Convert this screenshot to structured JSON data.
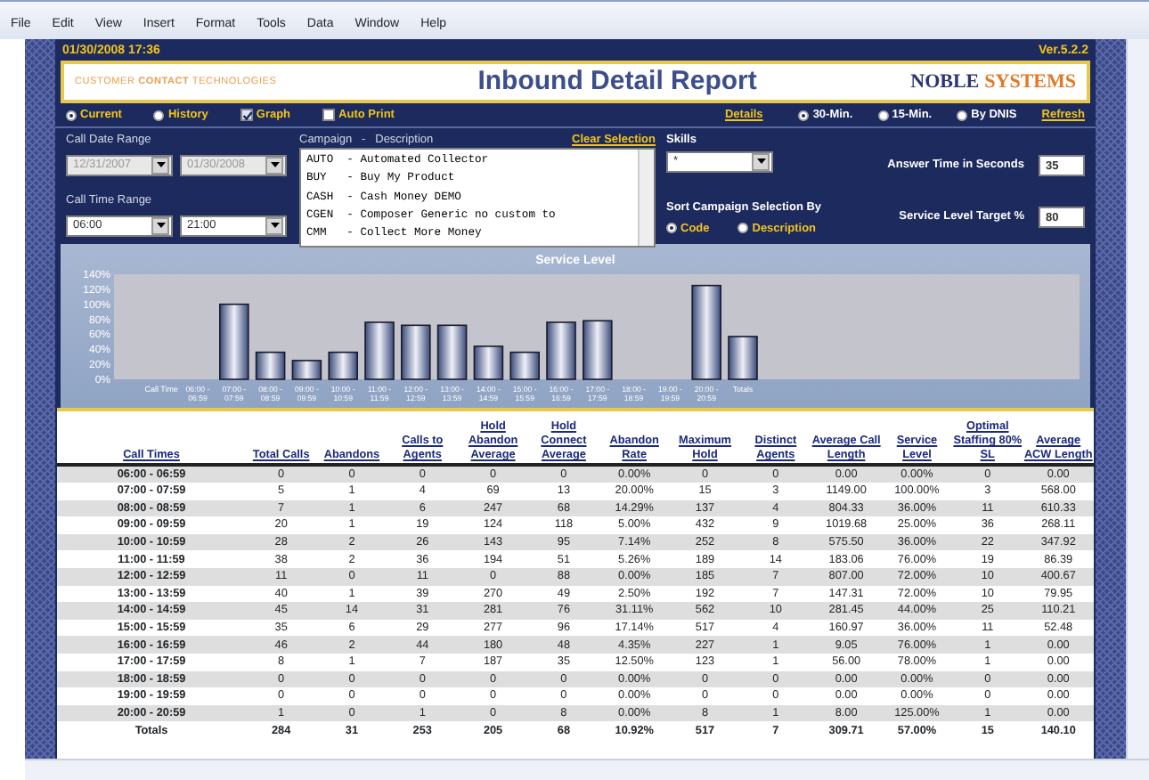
{
  "menu": [
    "File",
    "Edit",
    "View",
    "Insert",
    "Format",
    "Tools",
    "Data",
    "Window",
    "Help"
  ],
  "header": {
    "datetime": "01/30/2008 17:36",
    "version": "Ver.5.2.2",
    "tagline": "CUSTOMER **CONTACT** TECHNOLOGIES",
    "title": "Inbound Detail Report",
    "logo_word_1": "NOBLE",
    "logo_word_2": "SYSTEMS"
  },
  "mode_options": [
    {
      "label": "Current",
      "selected": true
    },
    {
      "label": "History",
      "selected": false
    }
  ],
  "checkboxes": [
    {
      "label": "Graph",
      "checked": true
    },
    {
      "label": "Auto Print",
      "checked": false
    }
  ],
  "details_link": "Details",
  "interval_options": [
    {
      "label": "30-Min.",
      "selected": true
    },
    {
      "label": "15-Min.",
      "selected": false
    },
    {
      "label": "By DNIS",
      "selected": false
    }
  ],
  "refresh_link": "Refresh",
  "call_date_range": {
    "label": "Call Date Range",
    "from": "12/31/2007",
    "to": "01/30/2008",
    "disabled": true
  },
  "call_time_range": {
    "label": "Call Time Range",
    "from": "06:00",
    "to": "21:00"
  },
  "campaign": {
    "label": "Campaign   -   Description",
    "clear_link": "Clear Selection",
    "items": [
      "AUTO  - Automated Collector",
      "BUY   - Buy My Product",
      "CASH  - Cash Money DEMO",
      "CGEN  - Composer Generic no custom to",
      "CMM   - Collect More Money"
    ]
  },
  "skill": {
    "label": "Skills",
    "value": "*"
  },
  "answer_time": {
    "label": "Answer Time in Seconds",
    "value": "35"
  },
  "sort": {
    "label": "Sort Campaign Selection By",
    "options": [
      {
        "label": "Code",
        "selected": true
      },
      {
        "label": "Description",
        "selected": false
      }
    ]
  },
  "service_target": {
    "label": "Service Level Target %",
    "value": "80"
  },
  "chart_data": {
    "type": "bar",
    "title": "Service Level",
    "xlabel": "Call Time",
    "categories": [
      "06:00 - 06:59",
      "07:00 - 07:59",
      "08:00 - 08:59",
      "09:00 - 09:59",
      "10:00 - 10:59",
      "11:00 - 11:59",
      "12:00 - 12:59",
      "13:00 - 13:59",
      "14:00 - 14:59",
      "15:00 - 15:59",
      "16:00 - 16:59",
      "17:00 - 17:59",
      "18:00 - 18:59",
      "19:00 - 19:59",
      "20:00 - 20:59",
      "Totals"
    ],
    "values": [
      0,
      100,
      36,
      25,
      36,
      76,
      72,
      72,
      44,
      36,
      76,
      78,
      0,
      0,
      125,
      57
    ],
    "ylim": [
      0,
      140
    ],
    "yticks": [
      {
        "value": 0,
        "label": "0%"
      },
      {
        "value": 20,
        "label": "20%"
      },
      {
        "value": 40,
        "label": "40%"
      },
      {
        "value": 60,
        "label": "60%"
      },
      {
        "value": 80,
        "label": "80%"
      },
      {
        "value": 100,
        "label": "100%"
      },
      {
        "value": 120,
        "label": "120%"
      },
      {
        "value": 140,
        "label": "140%"
      }
    ]
  },
  "table": {
    "columns": [
      "Call Times",
      "Total Calls",
      "Abandons",
      "Calls to Agents",
      "Hold Abandon Average",
      "Hold Connect Average",
      "Abandon Rate",
      "Maximum Hold",
      "Distinct Agents",
      "Average Call Length",
      "Service Level",
      "Optimal Staffing 80% SL",
      "Average ACW Length"
    ],
    "rows": [
      [
        "06:00 - 06:59",
        "0",
        "0",
        "0",
        "0",
        "0",
        "0.00%",
        "0",
        "0",
        "0.00",
        "0.00%",
        "0",
        "0.00"
      ],
      [
        "07:00 - 07:59",
        "5",
        "1",
        "4",
        "69",
        "13",
        "20.00%",
        "15",
        "3",
        "1149.00",
        "100.00%",
        "3",
        "568.00"
      ],
      [
        "08:00 - 08:59",
        "7",
        "1",
        "6",
        "247",
        "68",
        "14.29%",
        "137",
        "4",
        "804.33",
        "36.00%",
        "11",
        "610.33"
      ],
      [
        "09:00 - 09:59",
        "20",
        "1",
        "19",
        "124",
        "118",
        "5.00%",
        "432",
        "9",
        "1019.68",
        "25.00%",
        "36",
        "268.11"
      ],
      [
        "10:00 - 10:59",
        "28",
        "2",
        "26",
        "143",
        "95",
        "7.14%",
        "252",
        "8",
        "575.50",
        "36.00%",
        "22",
        "347.92"
      ],
      [
        "11:00 - 11:59",
        "38",
        "2",
        "36",
        "194",
        "51",
        "5.26%",
        "189",
        "14",
        "183.06",
        "76.00%",
        "19",
        "86.39"
      ],
      [
        "12:00 - 12:59",
        "11",
        "0",
        "11",
        "0",
        "88",
        "0.00%",
        "185",
        "7",
        "807.00",
        "72.00%",
        "10",
        "400.67"
      ],
      [
        "13:00 - 13:59",
        "40",
        "1",
        "39",
        "270",
        "49",
        "2.50%",
        "192",
        "7",
        "147.31",
        "72.00%",
        "10",
        "79.95"
      ],
      [
        "14:00 - 14:59",
        "45",
        "14",
        "31",
        "281",
        "76",
        "31.11%",
        "562",
        "10",
        "281.45",
        "44.00%",
        "25",
        "110.21"
      ],
      [
        "15:00 - 15:59",
        "35",
        "6",
        "29",
        "277",
        "96",
        "17.14%",
        "517",
        "4",
        "160.97",
        "36.00%",
        "11",
        "52.48"
      ],
      [
        "16:00 - 16:59",
        "46",
        "2",
        "44",
        "180",
        "48",
        "4.35%",
        "227",
        "1",
        "9.05",
        "76.00%",
        "1",
        "0.00"
      ],
      [
        "17:00 - 17:59",
        "8",
        "1",
        "7",
        "187",
        "35",
        "12.50%",
        "123",
        "1",
        "56.00",
        "78.00%",
        "1",
        "0.00"
      ],
      [
        "18:00 - 18:59",
        "0",
        "0",
        "0",
        "0",
        "0",
        "0.00%",
        "0",
        "0",
        "0.00",
        "0.00%",
        "0",
        "0.00"
      ],
      [
        "19:00 - 19:59",
        "0",
        "0",
        "0",
        "0",
        "0",
        "0.00%",
        "0",
        "0",
        "0.00",
        "0.00%",
        "0",
        "0.00"
      ],
      [
        "20:00 - 20:59",
        "1",
        "0",
        "1",
        "0",
        "8",
        "0.00%",
        "8",
        "1",
        "8.00",
        "125.00%",
        "1",
        "0.00"
      ]
    ],
    "totals": [
      "Totals",
      "284",
      "31",
      "253",
      "205",
      "68",
      "10.92%",
      "517",
      "7",
      "309.71",
      "57.00%",
      "15",
      "140.10"
    ]
  }
}
